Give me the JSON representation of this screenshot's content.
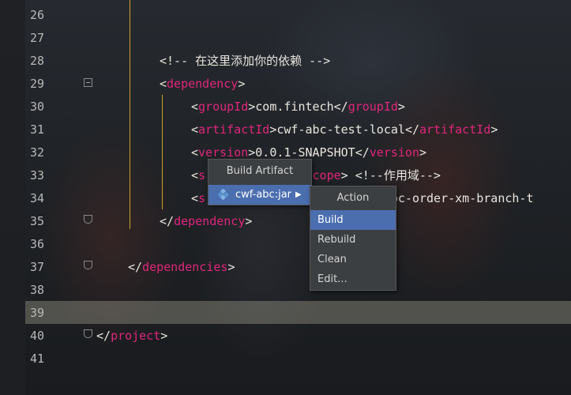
{
  "editor": {
    "lines": [
      {
        "num": "26",
        "parts": []
      },
      {
        "num": "27",
        "parts": []
      },
      {
        "num": "28",
        "indent": 80,
        "parts": [
          {
            "t": "<!-- 在这里添加你的依赖 -->",
            "c": "cmt"
          }
        ]
      },
      {
        "num": "29",
        "indent": 80,
        "parts": [
          {
            "t": "<",
            "c": "punc"
          },
          {
            "t": "dependency",
            "c": "tag"
          },
          {
            "t": ">",
            "c": "punc"
          }
        ]
      },
      {
        "num": "30",
        "indent": 120,
        "parts": [
          {
            "t": "<",
            "c": "punc"
          },
          {
            "t": "groupId",
            "c": "tag"
          },
          {
            "t": ">com.fintech</",
            "c": "txt"
          },
          {
            "t": "groupId",
            "c": "tag"
          },
          {
            "t": ">",
            "c": "punc"
          }
        ]
      },
      {
        "num": "31",
        "indent": 120,
        "parts": [
          {
            "t": "<",
            "c": "punc"
          },
          {
            "t": "artifactId",
            "c": "tag"
          },
          {
            "t": ">cwf-abc-test-local</",
            "c": "txt"
          },
          {
            "t": "artifactId",
            "c": "tag"
          },
          {
            "t": ">",
            "c": "punc"
          }
        ]
      },
      {
        "num": "32",
        "indent": 120,
        "parts": [
          {
            "t": "<",
            "c": "punc"
          },
          {
            "t": "version",
            "c": "tag"
          },
          {
            "t": ">0.0.1-SNAPSHOT</",
            "c": "txt"
          },
          {
            "t": "version",
            "c": "tag"
          },
          {
            "t": ">",
            "c": "punc"
          }
        ]
      },
      {
        "num": "33",
        "indent": 120,
        "parts": [
          {
            "t": "<",
            "c": "punc"
          },
          {
            "t": "s",
            "c": "tag"
          },
          {
            "t": "              ",
            "c": "txt"
          },
          {
            "t": "scope",
            "c": "tag"
          },
          {
            "t": "> <!--作用域-->",
            "c": "txt"
          }
        ]
      },
      {
        "num": "34",
        "indent": 120,
        "parts": [
          {
            "t": "<",
            "c": "punc"
          },
          {
            "t": "s",
            "c": "tag"
          },
          {
            "t": "                        \\abc-order-xm-branch-t",
            "c": "txt"
          }
        ]
      },
      {
        "num": "35",
        "indent": 80,
        "parts": [
          {
            "t": "</",
            "c": "punc"
          },
          {
            "t": "dependency",
            "c": "tag"
          },
          {
            "t": ">",
            "c": "punc"
          }
        ]
      },
      {
        "num": "36",
        "parts": []
      },
      {
        "num": "37",
        "indent": 40,
        "parts": [
          {
            "t": "</",
            "c": "punc"
          },
          {
            "t": "dependencies",
            "c": "tag"
          },
          {
            "t": ">",
            "c": "punc"
          }
        ]
      },
      {
        "num": "38",
        "parts": []
      },
      {
        "num": "39",
        "parts": []
      },
      {
        "num": "40",
        "indent": 0,
        "parts": [
          {
            "t": "</",
            "c": "punc"
          },
          {
            "t": "project",
            "c": "tag"
          },
          {
            "t": ">",
            "c": "punc"
          }
        ]
      },
      {
        "num": "41",
        "parts": []
      }
    ]
  },
  "build_popup": {
    "title": "Build Artifact",
    "selected_item": "cwf-abc:jar",
    "icon": "artifact-jar-icon",
    "submenu_arrow": "▶"
  },
  "action_popup": {
    "title": "Action",
    "items": [
      "Build",
      "Rebuild",
      "Clean",
      "Edit..."
    ],
    "active_item": "Build"
  },
  "colors": {
    "tag": "#e0267a",
    "text": "#e8e6e0",
    "guide": "#c9a227",
    "selection": "#4b6eaf",
    "popup_bg": "#3c3f41"
  }
}
